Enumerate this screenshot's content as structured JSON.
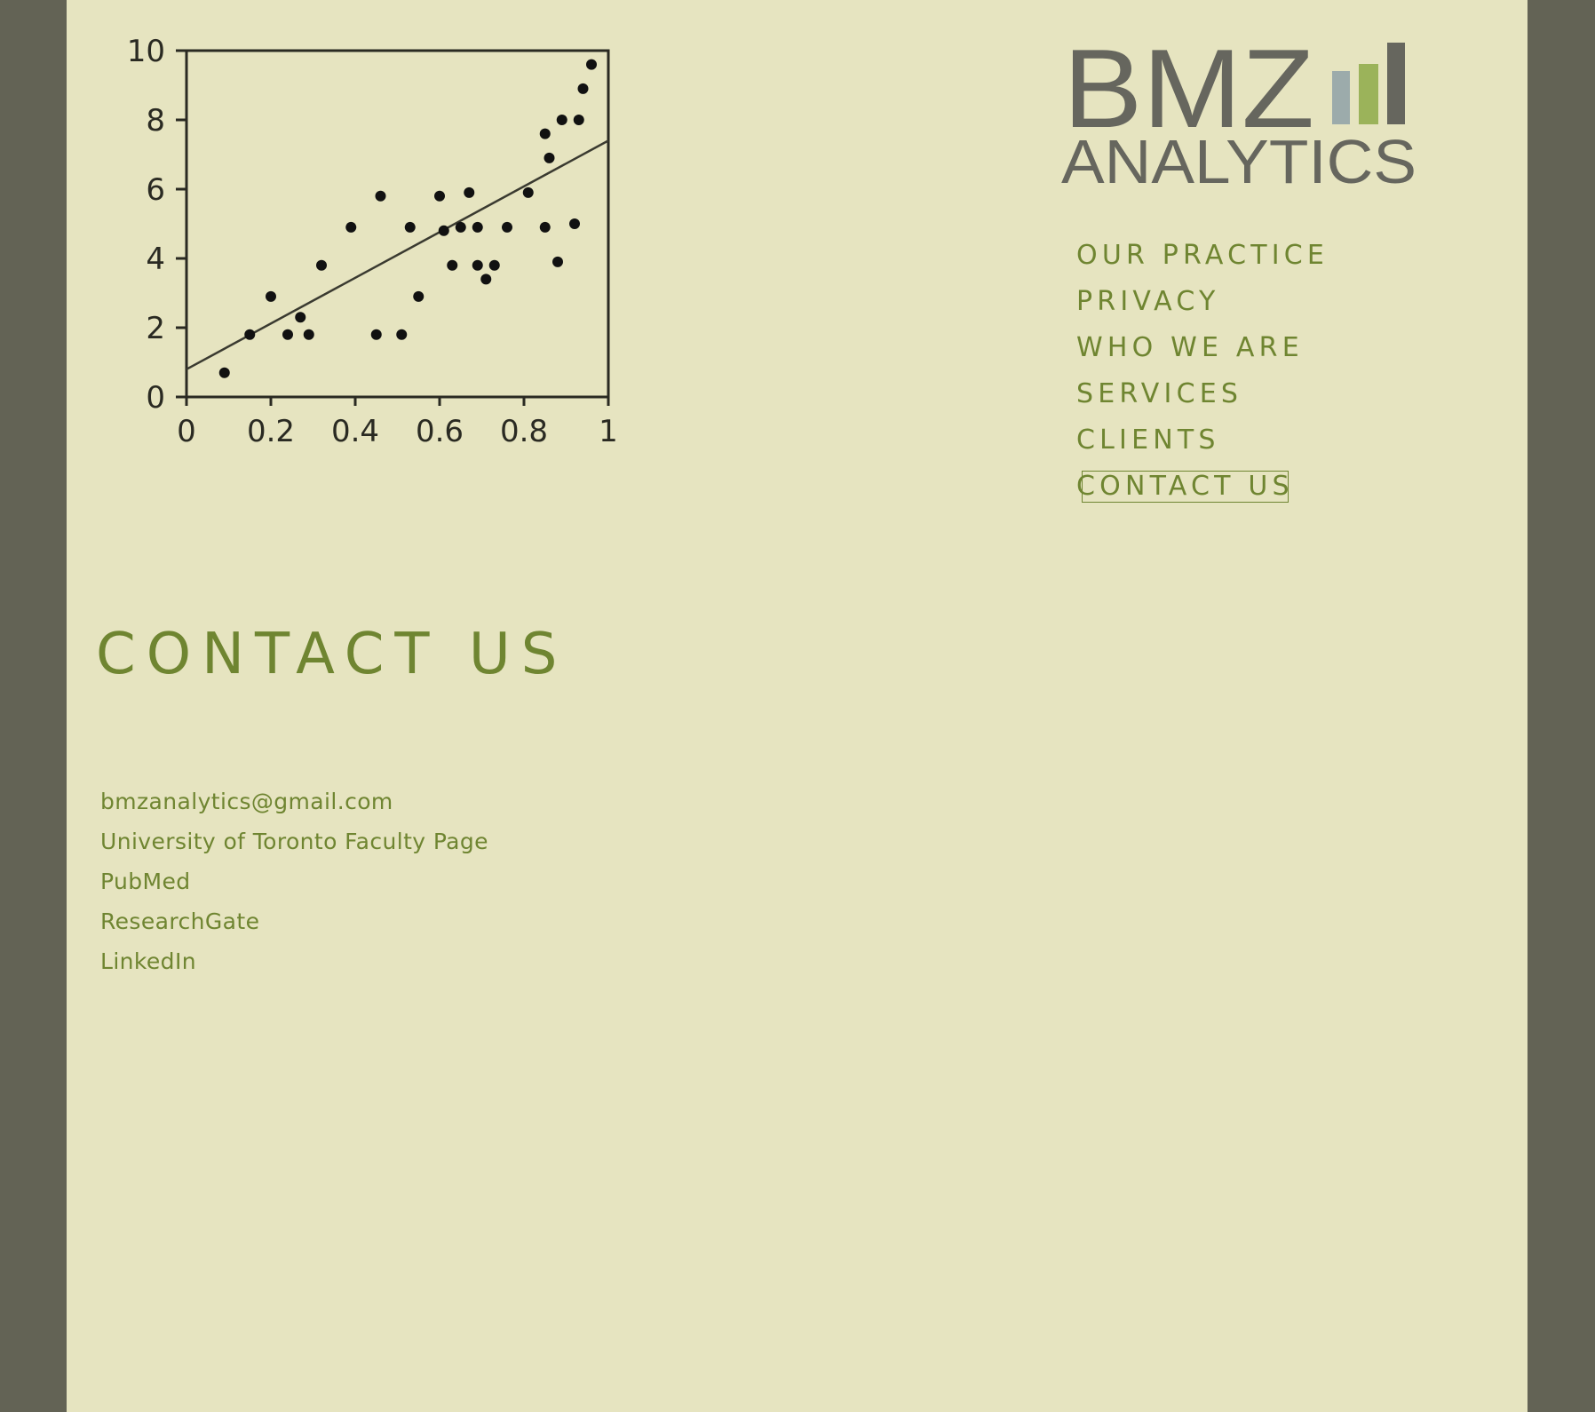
{
  "logo": {
    "line1": "BMZ",
    "line2": "ANALYTICS",
    "colors": {
      "text": "#66665e",
      "bar_dark": "#66665e",
      "bar_green": "#9bb35a",
      "bar_gray": "#9cabab"
    }
  },
  "nav": {
    "items": [
      {
        "label": "OUR PRACTICE"
      },
      {
        "label": "PRIVACY"
      },
      {
        "label": "WHO WE ARE"
      },
      {
        "label": "SERVICES"
      },
      {
        "label": "CLIENTS"
      },
      {
        "label": "CONTACT US",
        "active": true
      }
    ]
  },
  "main": {
    "title": "CONTACT US",
    "links": [
      {
        "label": "bmzanalytics@gmail.com"
      },
      {
        "label": "University of Toronto Faculty Page"
      },
      {
        "label": "PubMed"
      },
      {
        "label": "ResearchGate"
      },
      {
        "label": "LinkedIn"
      }
    ]
  },
  "colors": {
    "frame": "#636355",
    "page": "#e6e4c0",
    "accent": "#6f8531"
  },
  "chart_data": {
    "type": "scatter",
    "title": "",
    "xlabel": "",
    "ylabel": "",
    "xlim": [
      0,
      1
    ],
    "ylim": [
      0,
      10
    ],
    "xticks": [
      "0",
      "0.2",
      "0.4",
      "0.6",
      "0.8",
      "1"
    ],
    "yticks": [
      "0",
      "2",
      "4",
      "6",
      "8",
      "10"
    ],
    "grid": false,
    "points": [
      [
        0.09,
        0.7
      ],
      [
        0.15,
        1.8
      ],
      [
        0.2,
        2.9
      ],
      [
        0.24,
        1.8
      ],
      [
        0.27,
        2.3
      ],
      [
        0.29,
        1.8
      ],
      [
        0.32,
        3.8
      ],
      [
        0.39,
        4.9
      ],
      [
        0.45,
        1.8
      ],
      [
        0.46,
        5.8
      ],
      [
        0.51,
        1.8
      ],
      [
        0.53,
        4.9
      ],
      [
        0.55,
        2.9
      ],
      [
        0.6,
        5.8
      ],
      [
        0.61,
        4.8
      ],
      [
        0.63,
        3.8
      ],
      [
        0.65,
        4.9
      ],
      [
        0.67,
        5.9
      ],
      [
        0.69,
        4.9
      ],
      [
        0.69,
        3.8
      ],
      [
        0.71,
        3.4
      ],
      [
        0.73,
        3.8
      ],
      [
        0.76,
        4.9
      ],
      [
        0.81,
        5.9
      ],
      [
        0.85,
        4.9
      ],
      [
        0.85,
        7.6
      ],
      [
        0.86,
        6.9
      ],
      [
        0.88,
        3.9
      ],
      [
        0.89,
        8.0
      ],
      [
        0.92,
        5.0
      ],
      [
        0.93,
        8.0
      ],
      [
        0.94,
        8.9
      ],
      [
        0.96,
        9.6
      ]
    ],
    "trendline": {
      "x": [
        0,
        1
      ],
      "y": [
        0.8,
        7.4
      ]
    }
  }
}
